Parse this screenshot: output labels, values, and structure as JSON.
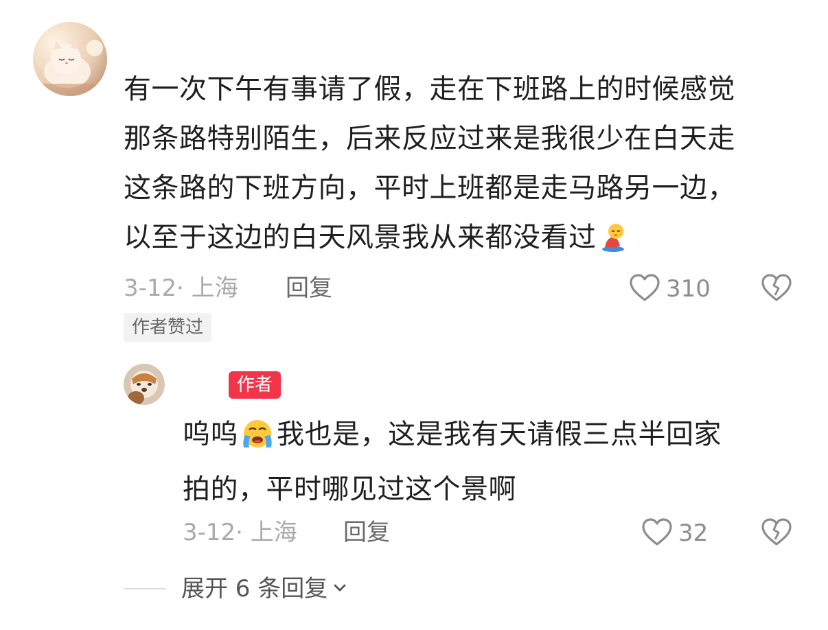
{
  "comment": {
    "text_lines": [
      "有一次下午有事请了假，走在下班路上的时候感觉",
      "那条路特别陌生，后来反应过来是我很少在白天走",
      "这条路的下班方向，平时上班都是走马路另一边，",
      "以至于这边的白天风景我从来都没看过"
    ],
    "emoji": "kneeling-person-emoji",
    "date_location": "3-12· 上海",
    "reply_label": "回复",
    "like_count": "310",
    "liked_by_author_badge": "作者赞过"
  },
  "reply": {
    "author_badge": "作者",
    "text_lines": [
      "呜呜",
      "我也是，这是我有天请假三点半回家",
      "拍的，平时哪见过这个景啊"
    ],
    "emoji": "loudly-crying-face-emoji",
    "date_location": "3-12· 上海",
    "reply_label": "回复",
    "like_count": "32"
  },
  "expand": {
    "label": "展开 6 条回复"
  },
  "icons": {
    "like": "heart-outline-icon",
    "dislike": "broken-heart-icon",
    "chevron": "chevron-down-icon"
  },
  "colors": {
    "author_badge_bg": "#f2354a",
    "meta_gray": "#a9a9a9",
    "text": "#1f1f1f"
  }
}
